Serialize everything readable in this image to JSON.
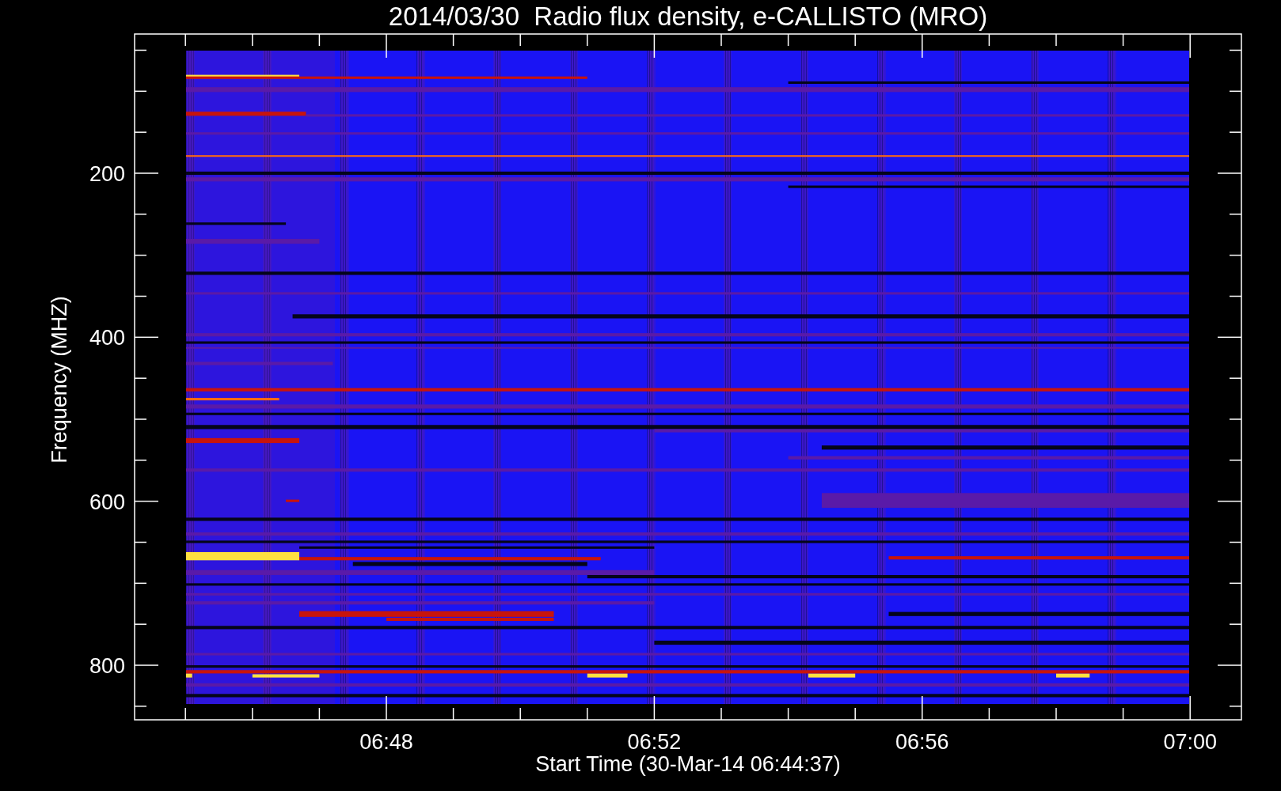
{
  "title": "2014/03/30  Radio flux density, e-CALLISTO (MRO)",
  "ylabel": "Frequency (MHZ)",
  "xlabel": "Start Time (30-Mar-14 06:44:37)",
  "yticks": [
    "200",
    "400",
    "600",
    "800"
  ],
  "xticks": [
    "06:48",
    "06:52",
    "06:56",
    "07:00"
  ]
}
